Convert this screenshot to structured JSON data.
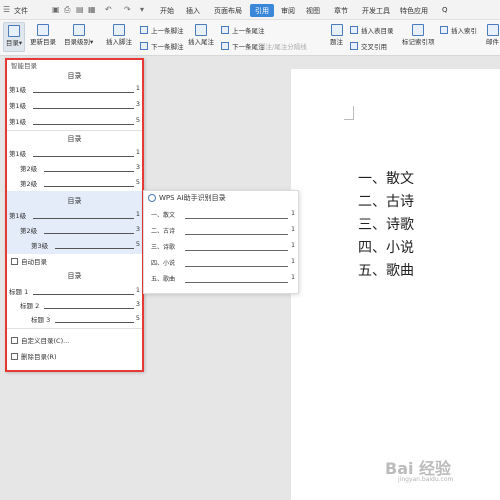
{
  "menubar": {
    "file": "文件",
    "tabs": [
      "开始",
      "插入",
      "页面布局",
      "引用",
      "审阅",
      "视图",
      "章节",
      "开发工具",
      "特色应用"
    ],
    "active_tab": "引用",
    "search": "Q"
  },
  "ribbon": {
    "toc": "目录",
    "update_toc": "更新目录",
    "toc_level": "目录级别",
    "insert_footnote": "插入脚注",
    "next_footnote": "下一条脚注",
    "insert_endnote": "插入尾注",
    "prev_endnote": "上一条尾注",
    "next_endnote": "下一条尾注",
    "footnote_sep": "脚注/尾注分隔线",
    "caption": "题注",
    "insert_table_toc": "插入表目录",
    "cross_ref": "交叉引用",
    "mark_index": "标记索引项",
    "insert_index": "插入索引",
    "mail": "邮件"
  },
  "dropdown": {
    "header": "智能目录",
    "sections": [
      {
        "title": "目录",
        "items": [
          {
            "label": "第1级",
            "page": "1",
            "indent": 0
          },
          {
            "label": "第1级",
            "page": "3",
            "indent": 0
          },
          {
            "label": "第1级",
            "page": "5",
            "indent": 0
          }
        ]
      },
      {
        "title": "目录",
        "items": [
          {
            "label": "第1级",
            "page": "1",
            "indent": 0
          },
          {
            "label": "第2级",
            "page": "3",
            "indent": 1
          },
          {
            "label": "第2级",
            "page": "5",
            "indent": 1
          }
        ]
      },
      {
        "title": "目录",
        "items": [
          {
            "label": "第1级",
            "page": "1",
            "indent": 0
          },
          {
            "label": "第2级",
            "page": "3",
            "indent": 1
          },
          {
            "label": "第3级",
            "page": "5",
            "indent": 2
          }
        ]
      }
    ],
    "auto_header": "自动目录",
    "auto_section": {
      "title": "目录",
      "items": [
        {
          "label": "标题 1",
          "page": "1",
          "indent": 0
        },
        {
          "label": "标题 2",
          "page": "3",
          "indent": 1
        },
        {
          "label": "标题 3",
          "page": "5",
          "indent": 2
        }
      ]
    },
    "custom": "自定义目录(C)...",
    "delete": "删除目录(R)"
  },
  "ai_panel": {
    "title": "WPS AI助手识别目录",
    "items": [
      {
        "label": "一、散文",
        "page": "1"
      },
      {
        "label": "二、古诗",
        "page": "1"
      },
      {
        "label": "三、诗歌",
        "page": "1"
      },
      {
        "label": "四、小说",
        "page": "1"
      },
      {
        "label": "五、歌曲",
        "page": "1"
      }
    ]
  },
  "document": {
    "headings": [
      "一、散文",
      "二、古诗",
      "三、诗歌",
      "四、小说",
      "五、歌曲"
    ]
  },
  "watermark": {
    "text": "Bai 经验",
    "sub": "jingyan.baidu.com"
  }
}
